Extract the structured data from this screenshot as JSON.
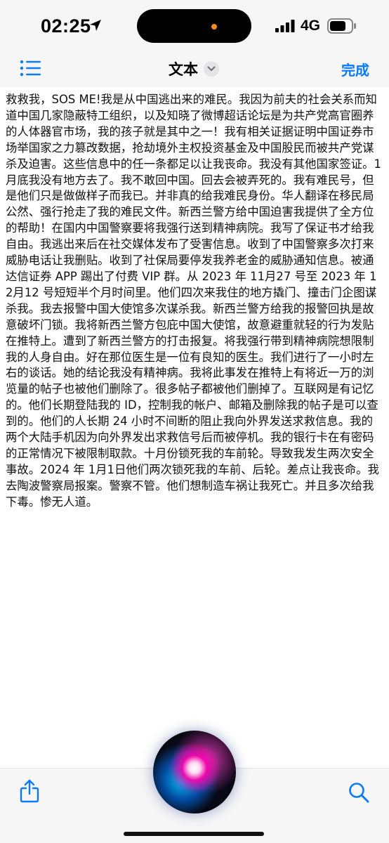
{
  "status_bar": {
    "time": "02:25",
    "network": "4G",
    "icons": [
      "location-arrow-icon",
      "cellular-signal-icon",
      "battery-icon"
    ]
  },
  "nav": {
    "title": "文本",
    "done_label": "完成",
    "icons": [
      "list-icon",
      "chevron-down-icon"
    ]
  },
  "document": {
    "text": "救救我，SOS ME!我是从中国逃出来的难民。我因为前夫的社会关系而知道中国几家隐蔽特工组织，以及知晓了微博超话论坛是为共产党高官圈养的人体器官市场，我的孩子就是其中之一！我有相关证据证明中国证券市场举国家之力篡改数据，抢劫境外主权投资基金及中国股民而被共产党谋杀及迫害。这些信息中的任一条都足以让我丧命。我没有其他国家签证。1月底我没有地方去了。我不敢回中国。回去会被弄死的。我有难民号，但是他们只是做做样子而我已。并非真的给我难民身份。华人翻译在移民局公然、强行抢走了我的难民文件。新西兰警方给中国迫害我提供了全方位的帮助！在国内中国警察要将我强行送到精神病院。我写了保证书才给我自由。我逃出来后在社交媒体发布了受害信息。收到了中国警察多次打来威胁电话让我删贴。收到了社保局要停发我养老金的威胁通知信息。被通达信证券 APP 踢出了付费 VIP 群。从 2023 年 11月27 号至 2023 年 12月12 号短短半个月时间里。他们四次来我住的地方撬门、撞击门企图谋杀我。我去报警中国大使馆多次谋杀我。新西兰警方给我的报警回执是故意破坏门锁。我将新西兰警方包庇中国大使馆，故意避重就轻的行为发贴在推特上。遭到了新西兰警方的打击报复。将我强行带到精神病院想限制我的人身自由。好在那位医生是一位有良知的医生。我们进行了一小时左右的谈话。她的结论我没有精神病。我将此事发在推特上有将近一万的浏览量的帖子也被他们删除了。很多帖子都被他们删掉了。互联网是有记忆的。他们长期登陆我的 ID，控制我的帐户、邮箱及删除我的帖子是可以查到的。他们的人长期 24 小时不间断的阻止我向外界发送求救信息。我的两个大陆手机因为向外界发出求救信号后而被停机。我的银行卡在有密码的正常情况下被限制取款。十月份锁死我的车前轮。导致我发生两次安全事故。2024 年 1月1日他们两次锁死我的车前、后轮。差点让我丧命。我去陶波警察局报案。警察不管。他们想制造车祸让我死亡。并且多次给我下毒。惨无人道。"
  },
  "toolbar": {
    "icons": [
      "share-icon",
      "siri-orb-icon",
      "search-icon"
    ]
  },
  "colors": {
    "accent": "#0a7aff",
    "bar_background": "#f6f6f7",
    "camera_dot": "#f58a1f"
  }
}
